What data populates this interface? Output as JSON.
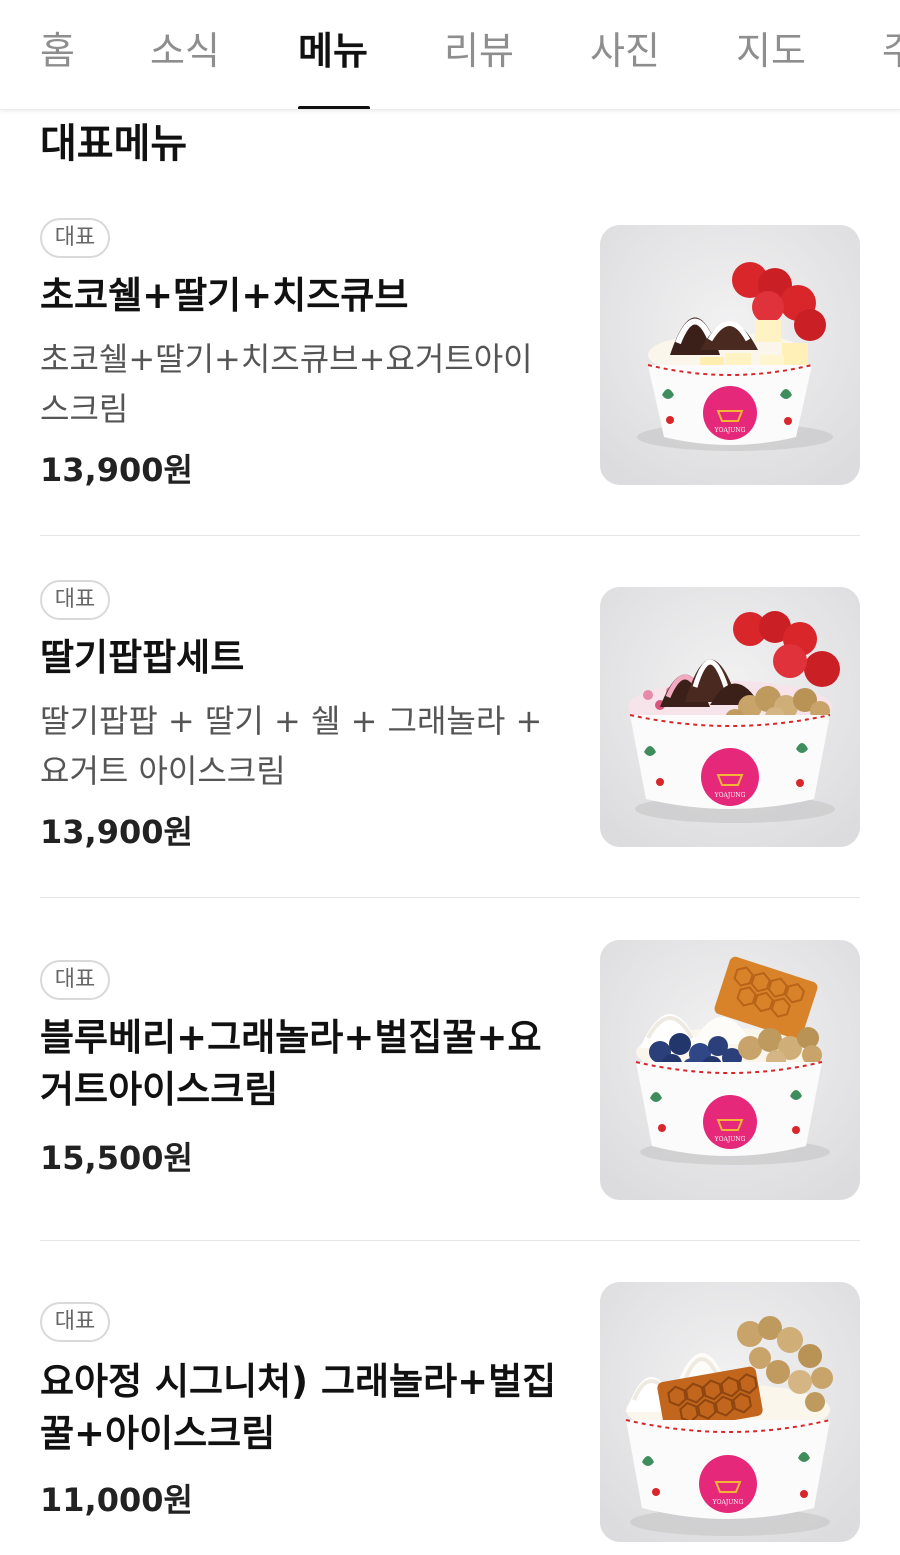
{
  "tabs": [
    {
      "label": "홈"
    },
    {
      "label": "소식"
    },
    {
      "label": "메뉴"
    },
    {
      "label": "리뷰"
    },
    {
      "label": "사진"
    },
    {
      "label": "지도"
    },
    {
      "label": "주"
    }
  ],
  "active_tab": "메뉴",
  "section_title": "대표메뉴",
  "menu_items": [
    {
      "badge": "대표",
      "name": "초코쉘+딸기+치즈큐브",
      "description": "초코쉘+딸기+치즈큐브+요거트아이스크림",
      "price": "13,900원",
      "image_icon": "icecream-bowl-strawberry-cheese"
    },
    {
      "badge": "대표",
      "name": "딸기팝팝세트",
      "description": "딸기팝팝 + 딸기 + 쉘 + 그래놀라 + 요거트 아이스크림",
      "price": "13,900원",
      "image_icon": "icecream-bowl-strawberry-granola"
    },
    {
      "badge": "대표",
      "name": "블루베리+그래놀라+벌집꿀+요거트아이스크림",
      "description": "",
      "price": "15,500원",
      "image_icon": "icecream-bowl-blueberry-honeycomb"
    },
    {
      "badge": "대표",
      "name": "요아정 시그니처) 그래놀라+벌집꿀+아이스크림",
      "description": "",
      "price": "11,000원",
      "image_icon": "icecream-bowl-honeycomb-granola"
    }
  ],
  "cup_logo_text": "YOAJUNG",
  "colors": {
    "active_tab": "#111111",
    "inactive_tab": "#8e8e8e",
    "cup_logo": "#e6287a",
    "strawberry": "#d9262b",
    "blueberry": "#2b3f7a",
    "honeycomb": "#d8832a"
  }
}
